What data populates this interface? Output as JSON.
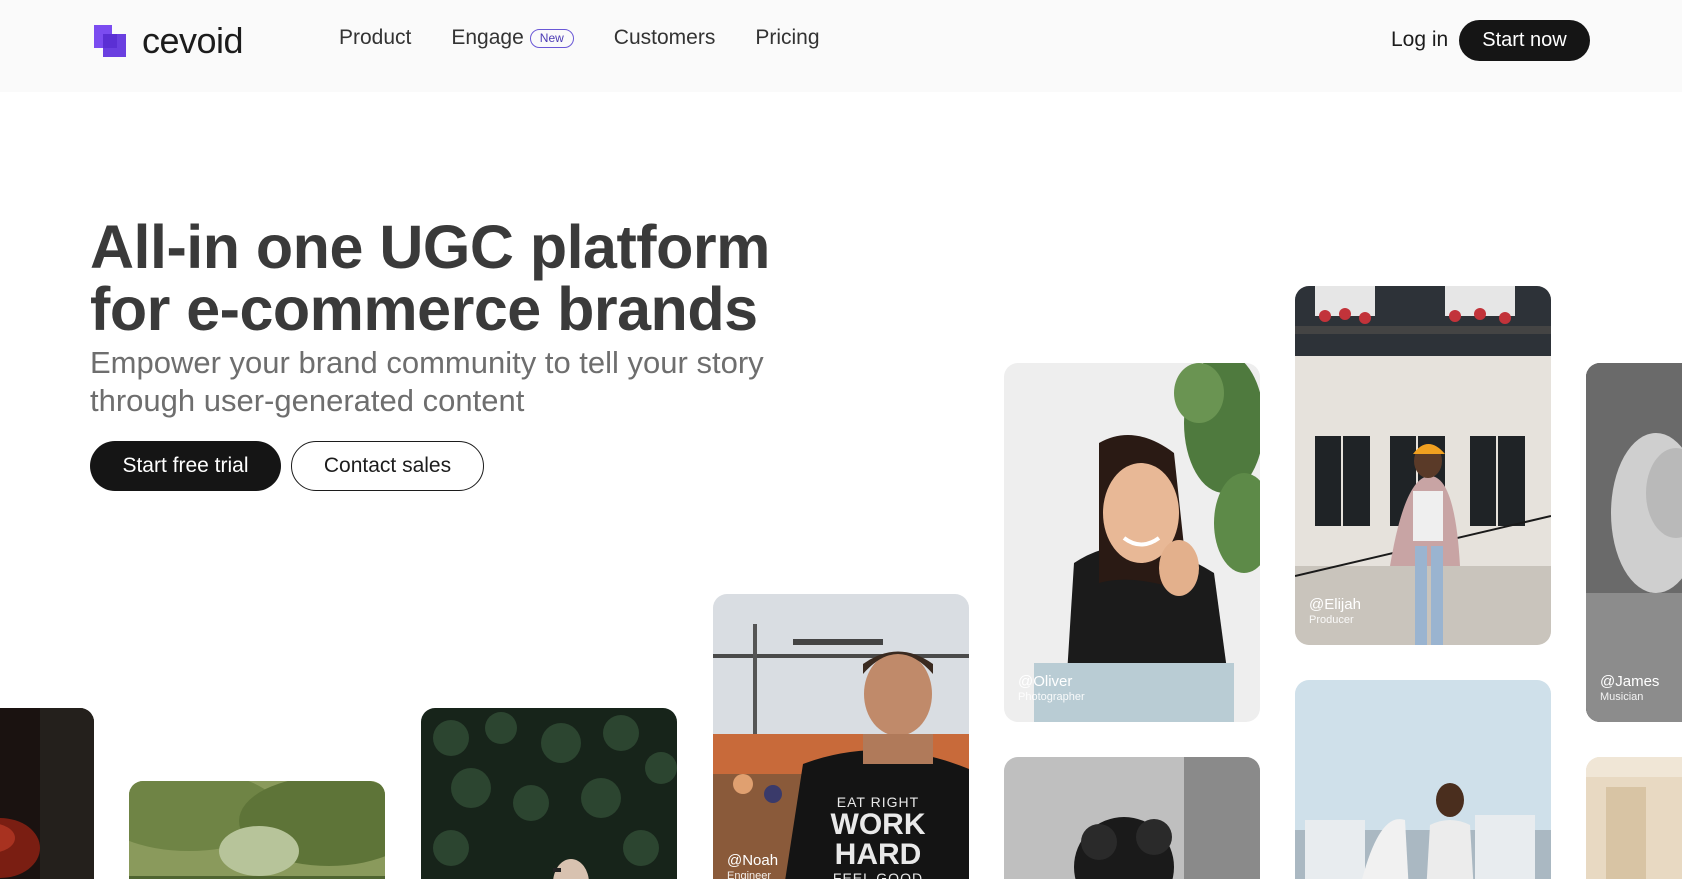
{
  "header": {
    "logo_text": "cevoid",
    "nav": [
      {
        "label": "Product"
      },
      {
        "label": "Engage",
        "badge": "New"
      },
      {
        "label": "Customers"
      },
      {
        "label": "Pricing"
      }
    ],
    "login_label": "Log in",
    "start_now_label": "Start now"
  },
  "hero": {
    "title_line1": "All-in one UGC platform",
    "title_line2": "for e-commerce brands",
    "subtitle_line1": "Empower your brand community to tell your story",
    "subtitle_line2": "through user-generated content",
    "primary_cta": "Start free trial",
    "secondary_cta": "Contact sales"
  },
  "cards": [
    {
      "handle": "@Oliver",
      "role": "Photographer"
    },
    {
      "handle": "@Elijah",
      "role": "Producer"
    },
    {
      "handle": "@James",
      "role": "Musician"
    },
    {
      "handle": "@Noah",
      "role": "Engineer",
      "shirt_line1": "EAT RIGHT",
      "shirt_line2": "WORK",
      "shirt_line3": "HARD",
      "shirt_line4": "FEEL GOOD"
    }
  ],
  "colors": {
    "brand": "#6a3fe0",
    "dark": "#151515",
    "header_bg": "#fafafa"
  }
}
